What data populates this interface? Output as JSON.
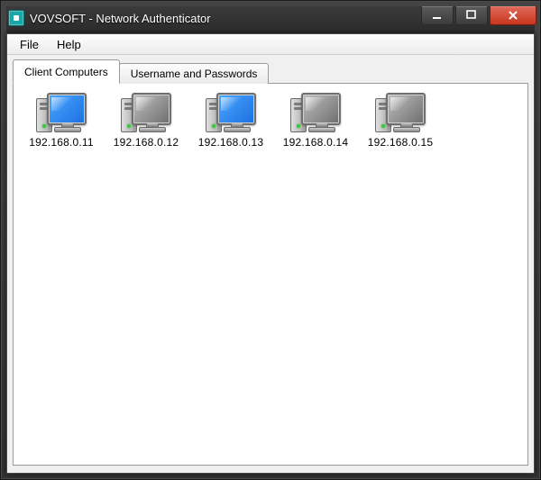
{
  "window": {
    "title": "VOVSOFT - Network Authenticator"
  },
  "menu": {
    "file": "File",
    "help": "Help"
  },
  "tabs": {
    "clients": "Client Computers",
    "creds": "Username and Passwords"
  },
  "clients": [
    {
      "ip": "192.168.0.11",
      "on": true
    },
    {
      "ip": "192.168.0.12",
      "on": false
    },
    {
      "ip": "192.168.0.13",
      "on": true
    },
    {
      "ip": "192.168.0.14",
      "on": false
    },
    {
      "ip": "192.168.0.15",
      "on": false
    }
  ]
}
